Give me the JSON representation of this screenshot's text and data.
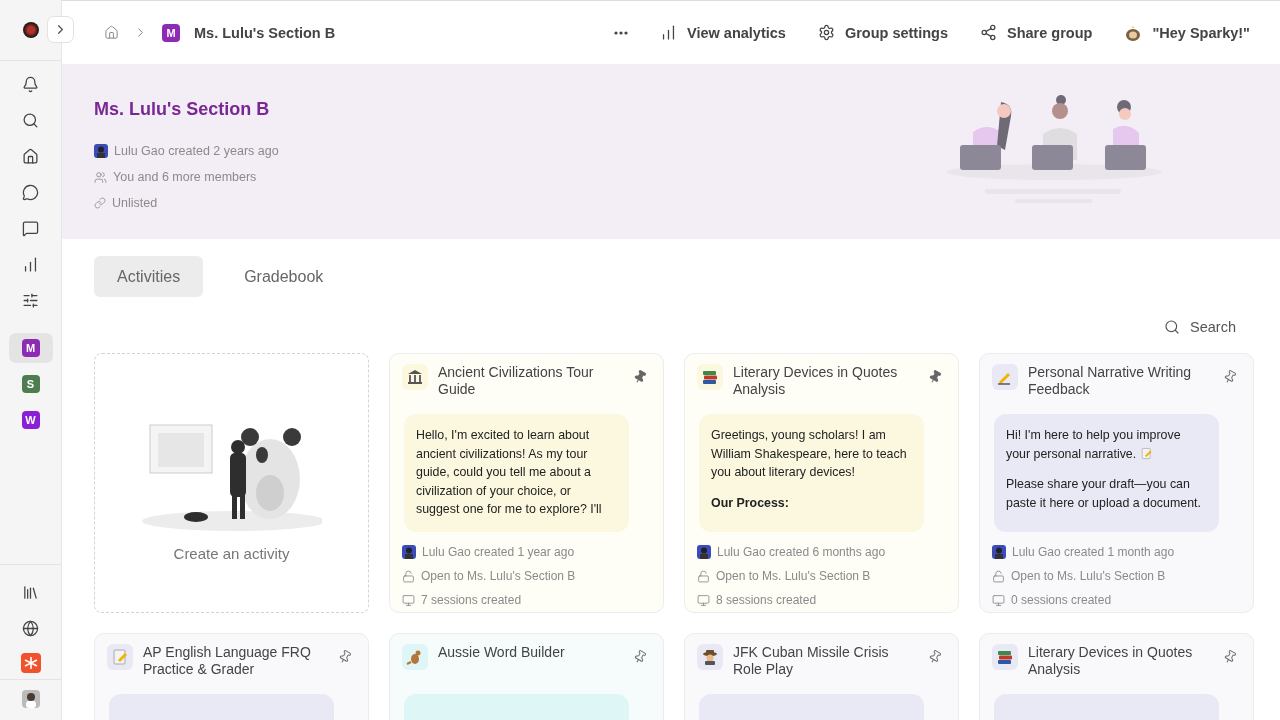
{
  "sidebar": {
    "groups": [
      {
        "letter": "M",
        "color": "#8e2bb5",
        "selected": true
      },
      {
        "letter": "S",
        "color": "#4f7d4f",
        "selected": false
      },
      {
        "letter": "W",
        "color": "#8a1fd6",
        "selected": false
      }
    ]
  },
  "breadcrumb": {
    "badge": "M",
    "title": "Ms. Lulu's Section B"
  },
  "toolbar": [
    {
      "kind": "analytics",
      "label": "View analytics"
    },
    {
      "kind": "settings",
      "label": "Group settings"
    },
    {
      "kind": "share",
      "label": "Share group"
    },
    {
      "kind": "mascot",
      "label": "\"Hey Sparky!\""
    }
  ],
  "header": {
    "title": "Ms. Lulu's Section B",
    "meta": [
      {
        "kind": "creator",
        "text": "Lulu Gao created 2 years ago"
      },
      {
        "kind": "members",
        "text": "You and 6 more members"
      },
      {
        "kind": "visibility",
        "text": "Unlisted"
      }
    ]
  },
  "tabs": [
    {
      "label": "Activities",
      "selected": true
    },
    {
      "label": "Gradebook",
      "selected": false
    }
  ],
  "search": {
    "label": "Search"
  },
  "create_card": {
    "label": "Create an activity"
  },
  "activities": [
    {
      "kind": "building",
      "title": "Ancient Civilizations Tour Guide",
      "color": "#fcf8df",
      "pinned": true,
      "message": [
        {
          "kind": "text",
          "text": "Hello, I'm excited to learn about ancient civilizations! As my tour guide, could you tell me about a civilization of your choice, or suggest one for me to explore? I'll"
        }
      ],
      "created": "Lulu Gao created 1 year ago",
      "access": "Open to Ms. Lulu's Section B",
      "sessions": "7 sessions created"
    },
    {
      "kind": "books",
      "title": "Literary Devices in Quotes Analysis",
      "color": "#fcf8df",
      "pinned": true,
      "message": [
        {
          "kind": "text",
          "text": "Greetings, young scholars! I am William Shakespeare, here to teach you about literary devices!"
        },
        {
          "kind": "heading",
          "text": "Our Process:"
        }
      ],
      "created": "Lulu Gao created 6 months ago",
      "access": "Open to Ms. Lulu's Section B",
      "sessions": "8 sessions created"
    },
    {
      "kind": "writing",
      "title": "Personal Narrative Writing Feedback",
      "color": "#e9e9f6",
      "pinned": false,
      "message": [
        {
          "kind": "text-memo",
          "text": "Hi! I'm here to help you improve your personal narrative."
        },
        {
          "kind": "text",
          "text": "Please share your draft—you can paste it here or upload a document."
        }
      ],
      "created": "Lulu Gao created 1 month ago",
      "access": "Open to Ms. Lulu's Section B",
      "sessions": "0 sessions created"
    },
    {
      "kind": "memo",
      "title": "AP English Language FRQ Practice & Grader",
      "color": "#e9e9f6",
      "pinned": false
    },
    {
      "kind": "kangaroo",
      "title": "Aussie Word Builder",
      "color": "#def6f6",
      "pinned": false
    },
    {
      "kind": "detective",
      "title": "JFK Cuban Missile Crisis Role Play",
      "color": "#e9e9f6",
      "pinned": false
    },
    {
      "kind": "books",
      "title": "Literary Devices in Quotes Analysis",
      "color": "#e9e9f6",
      "pinned": false
    }
  ]
}
